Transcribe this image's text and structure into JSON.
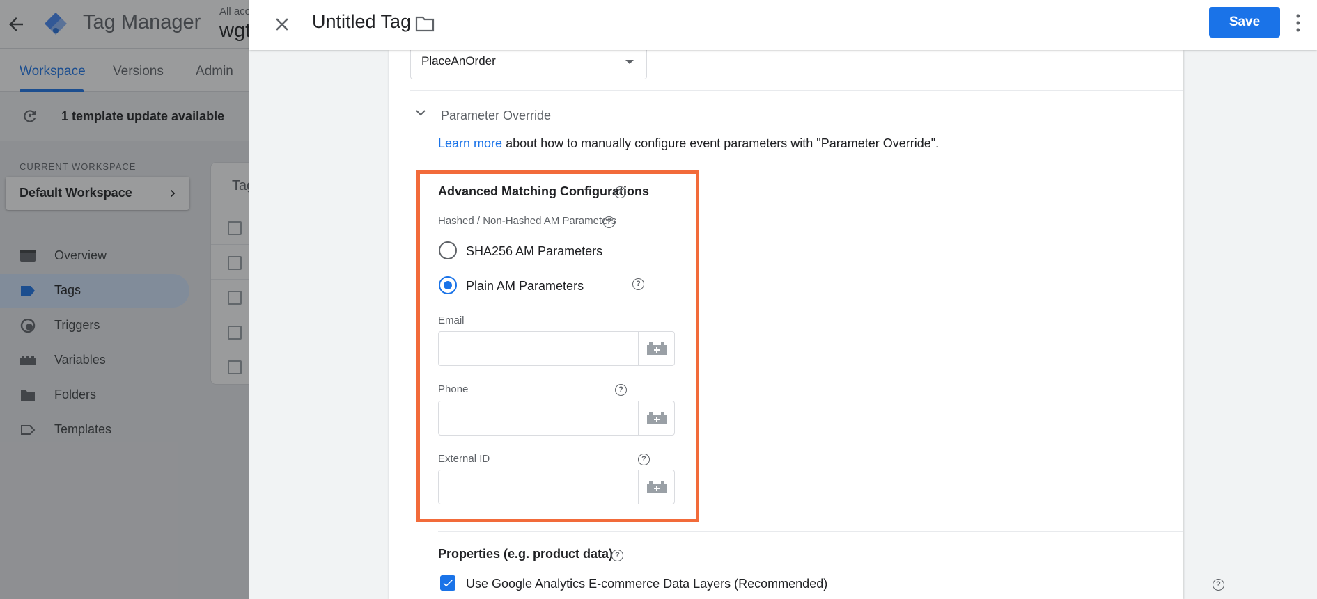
{
  "app": {
    "title": "Tag Manager",
    "account_label": "All acc",
    "account_name": "wgt"
  },
  "tabs": [
    {
      "label": "Workspace",
      "active": true
    },
    {
      "label": "Versions",
      "active": false
    },
    {
      "label": "Admin",
      "active": false
    }
  ],
  "notice": {
    "text": "1 template update available"
  },
  "workspace": {
    "section_label": "CURRENT WORKSPACE",
    "name": "Default Workspace"
  },
  "nav": [
    {
      "label": "Overview",
      "icon": "overview-icon",
      "active": false
    },
    {
      "label": "Tags",
      "icon": "tag-icon",
      "active": true
    },
    {
      "label": "Triggers",
      "icon": "trigger-icon",
      "active": false
    },
    {
      "label": "Variables",
      "icon": "variables-icon",
      "active": false
    },
    {
      "label": "Folders",
      "icon": "folder-icon",
      "active": false
    },
    {
      "label": "Templates",
      "icon": "template-icon",
      "active": false
    }
  ],
  "tags_card": {
    "title": "Tag"
  },
  "sheet": {
    "title": "Untitled Tag",
    "save_label": "Save"
  },
  "event": {
    "selected": "PlaceAnOrder"
  },
  "parameter_override": {
    "label": "Parameter Override",
    "link_text": "Learn more",
    "description": " about how to manually configure event parameters with \"Parameter Override\"."
  },
  "advanced_matching": {
    "title": "Advanced Matching Configurations",
    "sub_label": "Hashed / Non-Hashed AM Parameters",
    "options": [
      {
        "label": "SHA256 AM Parameters",
        "selected": false
      },
      {
        "label": "Plain AM Parameters",
        "selected": true
      }
    ],
    "fields": [
      {
        "label": "Email",
        "value": "",
        "help": false
      },
      {
        "label": "Phone",
        "value": "",
        "help": true
      },
      {
        "label": "External ID",
        "value": "",
        "help": true
      }
    ]
  },
  "properties": {
    "title": "Properties (e.g. product data)",
    "checkbox_label": "Use Google Analytics E-commerce Data Layers (Recommended)",
    "checked": true
  },
  "colors": {
    "accent": "#1a73e8",
    "highlight": "#f26b3a"
  }
}
